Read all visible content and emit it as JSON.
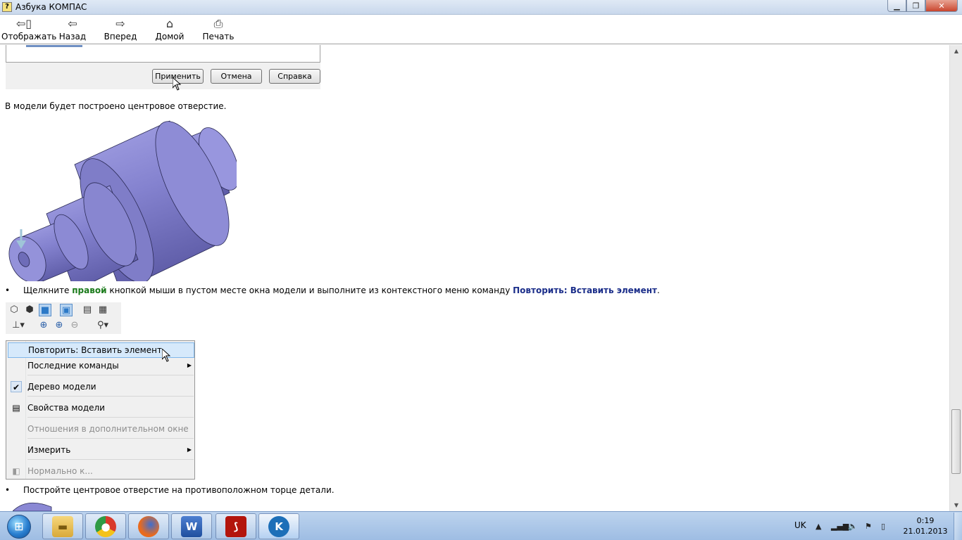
{
  "window": {
    "title": "Азбука КОМПАС"
  },
  "toolbar": [
    {
      "label": "Отображать",
      "icon": "show-hide-icon"
    },
    {
      "label": "Назад",
      "icon": "back-arrow-icon"
    },
    {
      "label": "Вперед",
      "icon": "forward-arrow-icon"
    },
    {
      "label": "Домой",
      "icon": "home-icon"
    },
    {
      "label": "Печать",
      "icon": "print-icon"
    }
  ],
  "dialog": {
    "buttons": [
      "Применить",
      "Отмена",
      "Справка"
    ]
  },
  "content": {
    "para1": "В модели будет построено центровое отверстие.",
    "bullet1": {
      "prefix": "Щелкните ",
      "highlight": "правой",
      "middle": " кнопкой мыши в пустом месте окна модели и выполните из контекстного меню команду ",
      "command": "Повторить: Вставить элемент",
      "suffix": "."
    },
    "bullet2": "Постройте центровое отверстие на противоположном торце детали."
  },
  "context_menu": {
    "items": [
      {
        "label": "Повторить: Вставить элемент",
        "highlighted": true
      },
      {
        "label": "Последние команды",
        "submenu": true
      },
      {
        "label": "Дерево модели",
        "checked": true
      },
      {
        "label": "Свойства модели",
        "icon": "properties-icon"
      },
      {
        "label": "Отношения в дополнительном окне",
        "disabled": true
      },
      {
        "label": "Измерить",
        "submenu": true
      },
      {
        "label": "Нормально к...",
        "disabled": true
      }
    ]
  },
  "taskbar": {
    "apps": [
      "file-explorer",
      "chrome",
      "firefox",
      "word",
      "acrobat",
      "kompas"
    ],
    "language": "UK",
    "time": "0:19",
    "date": "21.01.2013"
  },
  "colors": {
    "highlight_green": "#1a7a1a",
    "command_navy": "#1b2e8a",
    "model_purple": "#8a88d4"
  }
}
